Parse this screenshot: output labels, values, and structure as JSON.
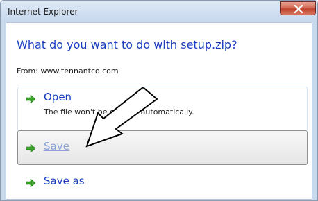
{
  "window": {
    "title": "Internet Explorer"
  },
  "dialog": {
    "question": "What do you want to do with setup.zip?",
    "from_text": "From: www.tennantco.com",
    "options": [
      {
        "label": "Open",
        "description": "The file won't be opened automatically."
      },
      {
        "label": "Save",
        "description": ""
      },
      {
        "label": "Save as",
        "description": ""
      }
    ]
  },
  "icons": {
    "close": "close-icon",
    "option_arrow": "green-arrow-icon",
    "pointer": "callout-arrow"
  },
  "colors": {
    "link_blue": "#1a3ec2",
    "arrow_green": "#3aa02a",
    "close_red": "#c0422c"
  }
}
